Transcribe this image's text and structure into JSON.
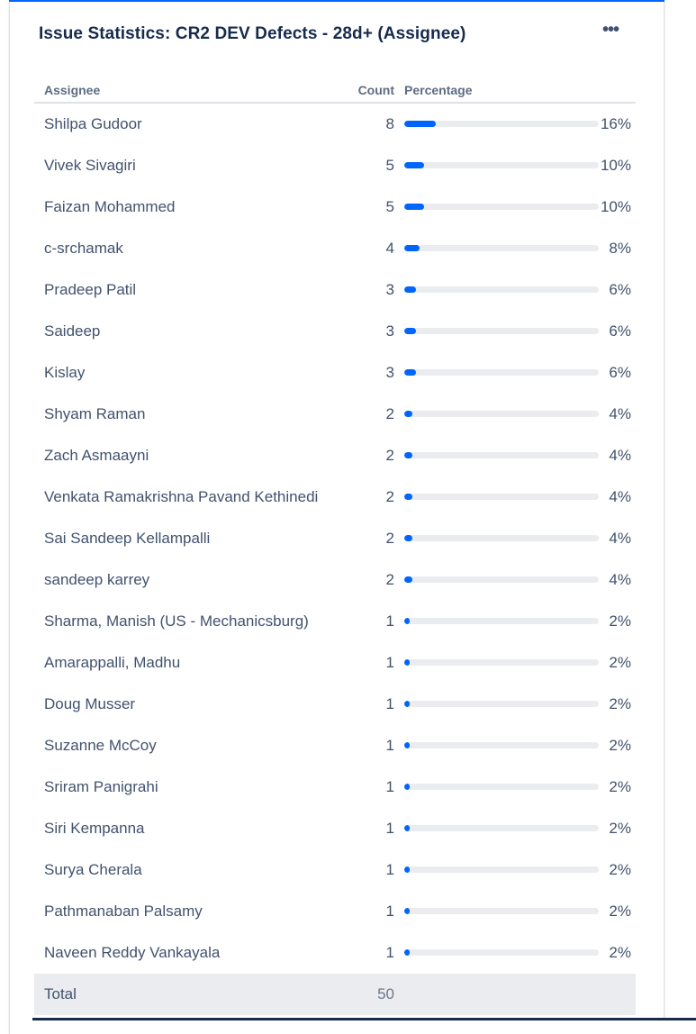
{
  "gadget": {
    "title": "Issue Statistics: CR2 DEV Defects - 28d+ (Assignee)",
    "more_icon": "more-horizontal-icon",
    "more_glyph": "•••"
  },
  "table": {
    "headers": {
      "assignee": "Assignee",
      "count": "Count",
      "percentage": "Percentage"
    },
    "rows": [
      {
        "name": "Shilpa Gudoor",
        "count": "8",
        "percent": "16%",
        "fraction": 0.16
      },
      {
        "name": "Vivek Sivagiri",
        "count": "5",
        "percent": "10%",
        "fraction": 0.1
      },
      {
        "name": "Faizan Mohammed",
        "count": "5",
        "percent": "10%",
        "fraction": 0.1
      },
      {
        "name": "c-srchamak",
        "count": "4",
        "percent": "8%",
        "fraction": 0.08
      },
      {
        "name": "Pradeep Patil",
        "count": "3",
        "percent": "6%",
        "fraction": 0.06
      },
      {
        "name": "Saideep",
        "count": "3",
        "percent": "6%",
        "fraction": 0.06
      },
      {
        "name": "Kislay",
        "count": "3",
        "percent": "6%",
        "fraction": 0.06
      },
      {
        "name": "Shyam Raman",
        "count": "2",
        "percent": "4%",
        "fraction": 0.04
      },
      {
        "name": "Zach Asmaayni",
        "count": "2",
        "percent": "4%",
        "fraction": 0.04
      },
      {
        "name": "Venkata Ramakrishna Pavand Kethinedi",
        "count": "2",
        "percent": "4%",
        "fraction": 0.04
      },
      {
        "name": "Sai Sandeep Kellampalli",
        "count": "2",
        "percent": "4%",
        "fraction": 0.04
      },
      {
        "name": "sandeep karrey",
        "count": "2",
        "percent": "4%",
        "fraction": 0.04
      },
      {
        "name": "Sharma, Manish (US - Mechanicsburg)",
        "count": "1",
        "percent": "2%",
        "fraction": 0.02
      },
      {
        "name": "Amarappalli, Madhu",
        "count": "1",
        "percent": "2%",
        "fraction": 0.02
      },
      {
        "name": "Doug Musser",
        "count": "1",
        "percent": "2%",
        "fraction": 0.02
      },
      {
        "name": "Suzanne McCoy",
        "count": "1",
        "percent": "2%",
        "fraction": 0.02
      },
      {
        "name": "Sriram Panigrahi",
        "count": "1",
        "percent": "2%",
        "fraction": 0.02
      },
      {
        "name": "Siri Kempanna",
        "count": "1",
        "percent": "2%",
        "fraction": 0.02
      },
      {
        "name": "Surya Cherala",
        "count": "1",
        "percent": "2%",
        "fraction": 0.02
      },
      {
        "name": "Pathmanaban Palsamy",
        "count": "1",
        "percent": "2%",
        "fraction": 0.02
      },
      {
        "name": "Naveen Reddy Vankayala",
        "count": "1",
        "percent": "2%",
        "fraction": 0.02
      }
    ],
    "total": {
      "label": "Total",
      "count": "50"
    }
  },
  "colors": {
    "bar_fill": "#0065ff",
    "bar_track": "#ebecf0",
    "total_row_bg": "#ebecf0",
    "accent": "#0065ff"
  }
}
